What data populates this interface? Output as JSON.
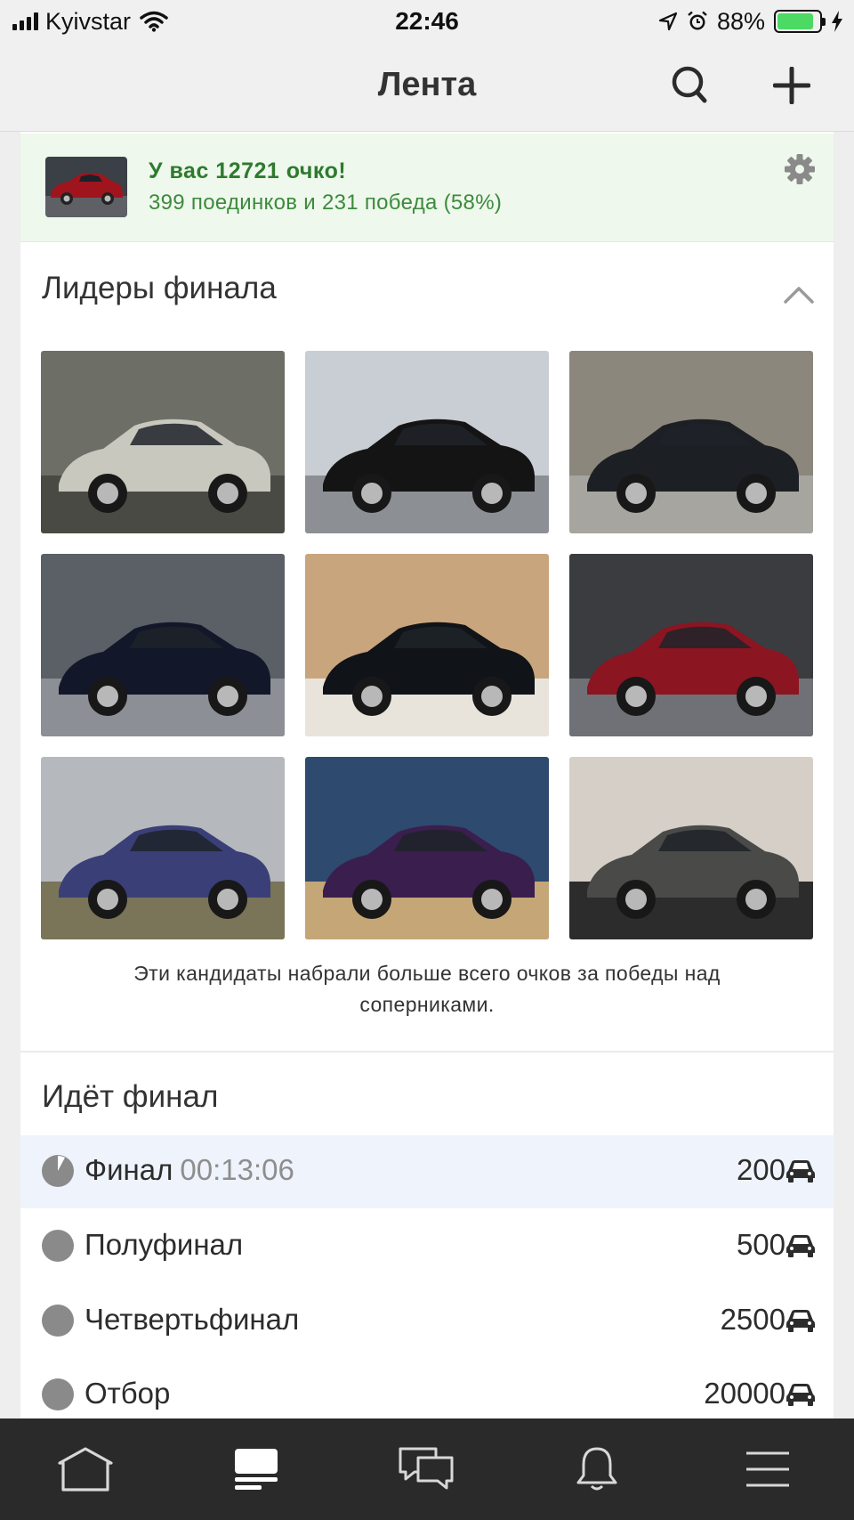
{
  "status_bar": {
    "carrier": "Kyivstar",
    "time": "22:46",
    "battery_percent": "88%",
    "battery_level": 0.88
  },
  "nav": {
    "title": "Лента",
    "icons": [
      "search-icon",
      "plus-icon"
    ]
  },
  "score": {
    "title": "У вас 12721 очко!",
    "subtitle": "399 поединков и 231 победа (58%)"
  },
  "leaders": {
    "heading": "Лидеры финала",
    "photos": [
      {
        "desc": "silver-car-garage",
        "colors": [
          "#6d6e66",
          "#c9c8bf",
          "#4a4a45"
        ]
      },
      {
        "desc": "black-sedan-dock",
        "colors": [
          "#c9cdd4",
          "#141414",
          "#8c8f94"
        ]
      },
      {
        "desc": "black-wagon-forest",
        "colors": [
          "#8b877c",
          "#1c1f24",
          "#a7a5a0"
        ]
      },
      {
        "desc": "dark-blue-jaguar",
        "colors": [
          "#5b5f66",
          "#12172a",
          "#8c8f96"
        ]
      },
      {
        "desc": "black-hatchback-brick",
        "colors": [
          "#c9a57e",
          "#101418",
          "#e8e4dc"
        ]
      },
      {
        "desc": "red-sedan-parking",
        "colors": [
          "#3a3c40",
          "#8c1522",
          "#6f7177"
        ]
      },
      {
        "desc": "purple-coupe-trees",
        "colors": [
          "#b5b9bd",
          "#3b3f78",
          "#7a7458"
        ]
      },
      {
        "desc": "purple-coupe-sand",
        "colors": [
          "#2e4a6e",
          "#3a1e4e",
          "#c4a677"
        ]
      },
      {
        "desc": "grey-wagon-parking",
        "colors": [
          "#d6cfc7",
          "#4a4b48",
          "#2c2c2c"
        ]
      }
    ],
    "caption": "Эти кандидаты набрали больше всего очков за победы над соперниками."
  },
  "final": {
    "heading": "Идёт финал",
    "rounds": [
      {
        "label": "Финал",
        "timer": "00:13:06",
        "count": "200",
        "active": true
      },
      {
        "label": "Полуфинал",
        "timer": "",
        "count": "500",
        "active": false
      },
      {
        "label": "Четвертьфинал",
        "timer": "",
        "count": "2500",
        "active": false
      },
      {
        "label": "Отбор",
        "timer": "",
        "count": "20000",
        "active": false
      }
    ]
  },
  "tab_bar": {
    "tabs": [
      "home-icon",
      "feed-icon",
      "messages-icon",
      "notifications-icon",
      "menu-icon"
    ],
    "active": "feed-icon"
  },
  "colors": {
    "score_green": "#2e7a2e",
    "score_bg": "#eef8ec",
    "active_row_bg": "#eef3fc",
    "tab_bar_bg": "#2a2a2a"
  }
}
